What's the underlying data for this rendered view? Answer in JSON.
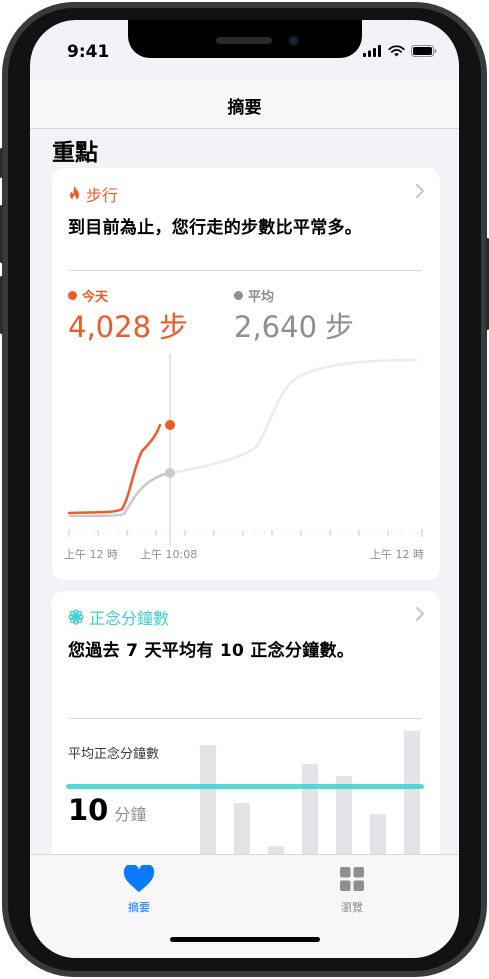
{
  "status_bar": {
    "time": "9:41"
  },
  "nav": {
    "title": "摘要"
  },
  "section": {
    "title": "重點"
  },
  "steps_card": {
    "category": "步行",
    "message": "到目前為止，您行走的步數比平常多。",
    "today_label": "今天",
    "today_value": "4,028",
    "today_unit": "步",
    "avg_label": "平均",
    "avg_value": "2,640",
    "avg_unit": "步",
    "x_labels": [
      "上午 12 時",
      "上午 10:08",
      "上午 12 時"
    ]
  },
  "mindful_card": {
    "category": "正念分鐘數",
    "message": "您過去 7 天平均有 10 正念分鐘數。",
    "avg_label": "平均正念分鐘數",
    "avg_value": "10",
    "avg_unit": "分鐘"
  },
  "tabs": [
    {
      "label": "摘要",
      "active": true,
      "icon": "heart-icon"
    },
    {
      "label": "瀏覽",
      "active": false,
      "icon": "grid-icon"
    }
  ],
  "colors": {
    "steps_accent": "#f05a28",
    "mindful_accent": "#3ccfcf",
    "tab_active": "#0a7aff",
    "tab_inactive": "#8e8e93",
    "avg_gray": "#8e8e93"
  }
}
